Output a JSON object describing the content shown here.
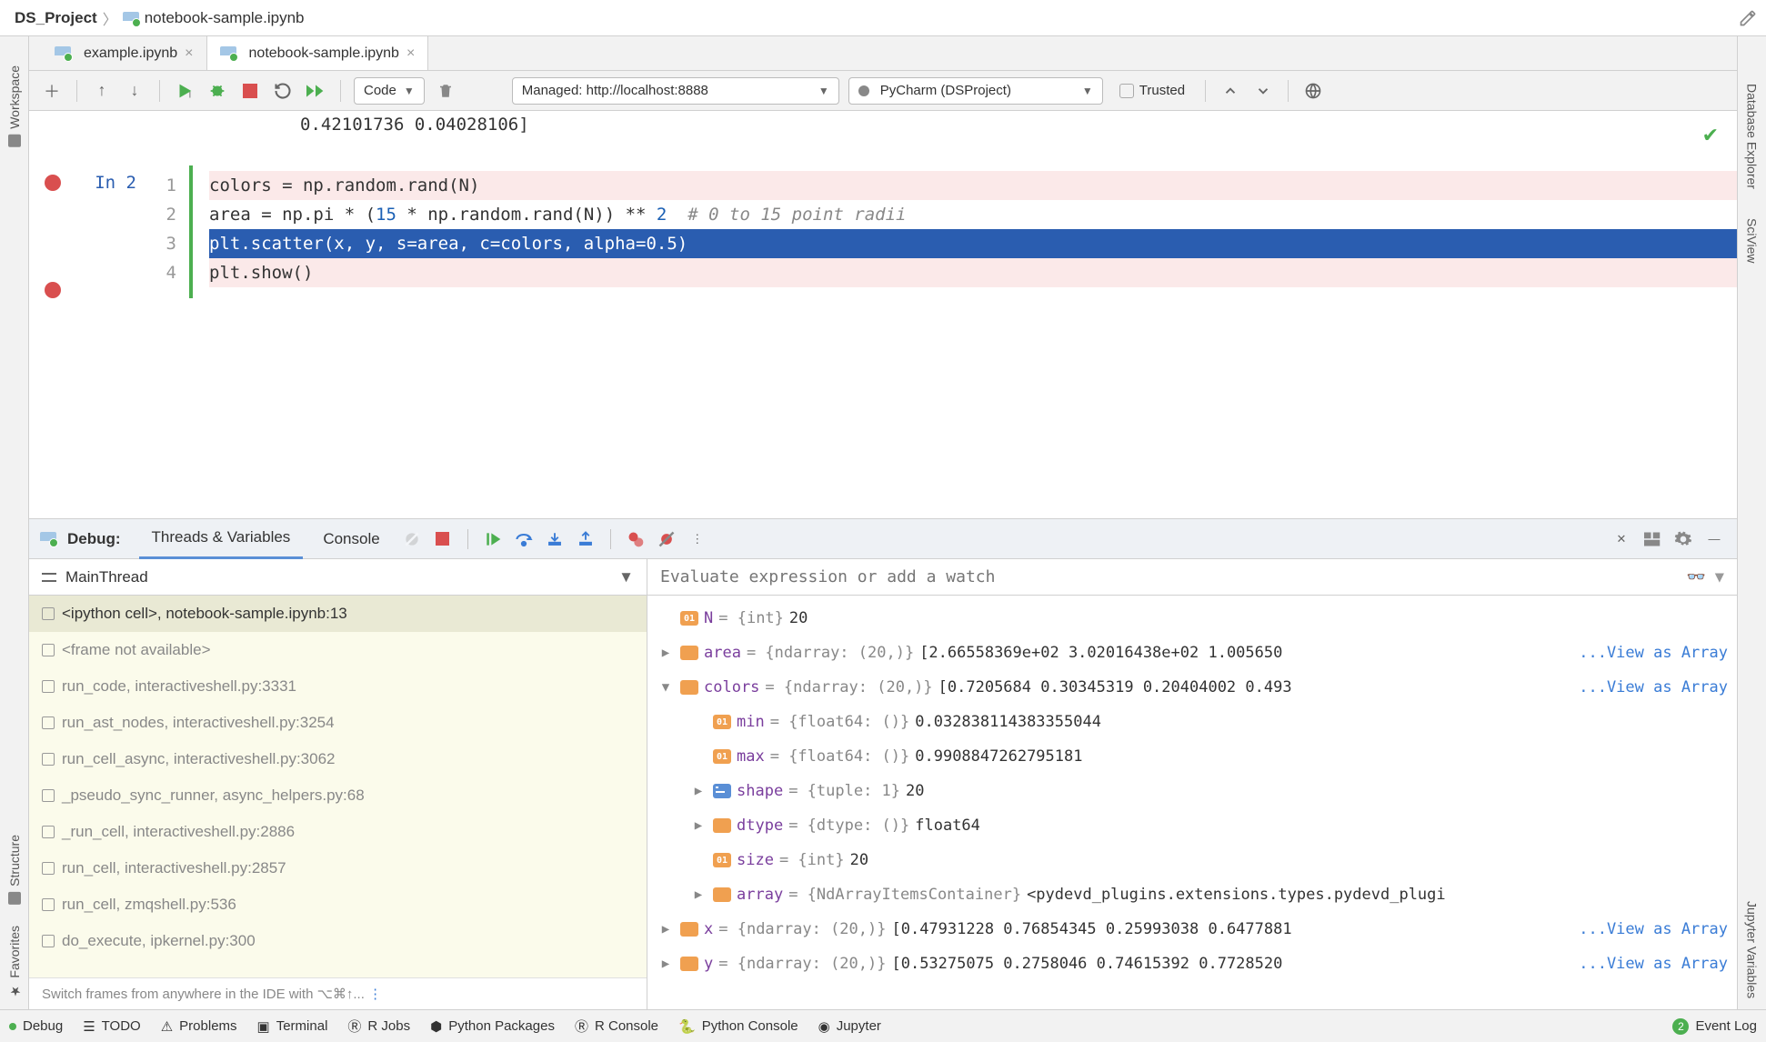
{
  "breadcrumb": {
    "project": "DS_Project",
    "file": "notebook-sample.ipynb"
  },
  "tabs": [
    {
      "label": "example.ipynb",
      "active": false
    },
    {
      "label": "notebook-sample.ipynb",
      "active": true
    }
  ],
  "nb_toolbar": {
    "cell_type": "Code",
    "server": "Managed: http://localhost:8888",
    "kernel": "PyCharm (DSProject)",
    "trusted_label": "Trusted"
  },
  "editor": {
    "prev_output": "0.42101736 0.04028106]",
    "in_label": "In 2",
    "lines": [
      "colors = np.random.rand(N)",
      "area = np.pi * (15 * np.random.rand(N)) ** 2  # 0 to 15 point radii",
      "plt.scatter(x, y, s=area, c=colors, alpha=0.5)",
      "plt.show()"
    ]
  },
  "debug": {
    "title": "Debug:",
    "tabs": {
      "threads": "Threads & Variables",
      "console": "Console"
    },
    "thread_name": "MainThread",
    "watch_placeholder": "Evaluate expression or add a watch",
    "frames": [
      "<ipython cell>, notebook-sample.ipynb:13",
      "<frame not available>",
      "run_code, interactiveshell.py:3331",
      "run_ast_nodes, interactiveshell.py:3254",
      "run_cell_async, interactiveshell.py:3062",
      "_pseudo_sync_runner, async_helpers.py:68",
      "_run_cell, interactiveshell.py:2886",
      "run_cell, interactiveshell.py:2857",
      "run_cell, zmqshell.py:536",
      "do_execute, ipkernel.py:300"
    ],
    "frames_hint": "Switch frames from anywhere in the IDE with ⌥⌘↑...",
    "vars": [
      {
        "indent": 0,
        "expand": "",
        "badge": "int",
        "name": "N",
        "type": "{int}",
        "val": "20",
        "link": ""
      },
      {
        "indent": 0,
        "expand": "▶",
        "badge": "arr",
        "name": "area",
        "type": "{ndarray: (20,)}",
        "val": "[2.66558369e+02 3.02016438e+02 1.005650",
        "link": "...View as Array"
      },
      {
        "indent": 0,
        "expand": "▼",
        "badge": "arr",
        "name": "colors",
        "type": "{ndarray: (20,)}",
        "val": "[0.7205684  0.30345319 0.20404002 0.493",
        "link": "...View as Array"
      },
      {
        "indent": 1,
        "expand": "",
        "badge": "int",
        "name": "min",
        "type": "{float64: ()}",
        "val": "0.032838114383355044",
        "link": ""
      },
      {
        "indent": 1,
        "expand": "",
        "badge": "int",
        "name": "max",
        "type": "{float64: ()}",
        "val": "0.9908847262795181",
        "link": ""
      },
      {
        "indent": 1,
        "expand": "▶",
        "badge": "struct",
        "name": "shape",
        "type": "{tuple: 1}",
        "val": "20",
        "link": ""
      },
      {
        "indent": 1,
        "expand": "▶",
        "badge": "arr",
        "name": "dtype",
        "type": "{dtype: ()}",
        "val": "float64",
        "link": ""
      },
      {
        "indent": 1,
        "expand": "",
        "badge": "int",
        "name": "size",
        "type": "{int}",
        "val": "20",
        "link": ""
      },
      {
        "indent": 1,
        "expand": "▶",
        "badge": "arr",
        "name": "array",
        "type": "{NdArrayItemsContainer}",
        "val": "<pydevd_plugins.extensions.types.pydevd_plugi",
        "link": ""
      },
      {
        "indent": 0,
        "expand": "▶",
        "badge": "arr",
        "name": "x",
        "type": "{ndarray: (20,)}",
        "val": "[0.47931228 0.76854345 0.25993038 0.6477881",
        "link": "...View as Array"
      },
      {
        "indent": 0,
        "expand": "▶",
        "badge": "arr",
        "name": "y",
        "type": "{ndarray: (20,)}",
        "val": "[0.53275075 0.2758046  0.74615392 0.7728520",
        "link": "...View as Array"
      }
    ]
  },
  "side_rails": {
    "left": [
      {
        "label": "Workspace"
      },
      {
        "label": "Structure"
      },
      {
        "label": "Favorites"
      }
    ],
    "right": [
      {
        "label": "Database Explorer"
      },
      {
        "label": "SciView"
      },
      {
        "label": "Jupyter Variables"
      }
    ]
  },
  "status_bar": {
    "items_left": [
      "Debug",
      "TODO",
      "Problems",
      "Terminal",
      "R Jobs",
      "Python Packages",
      "R Console",
      "Python Console",
      "Jupyter"
    ],
    "event_log": "Event Log",
    "event_count": "2"
  }
}
